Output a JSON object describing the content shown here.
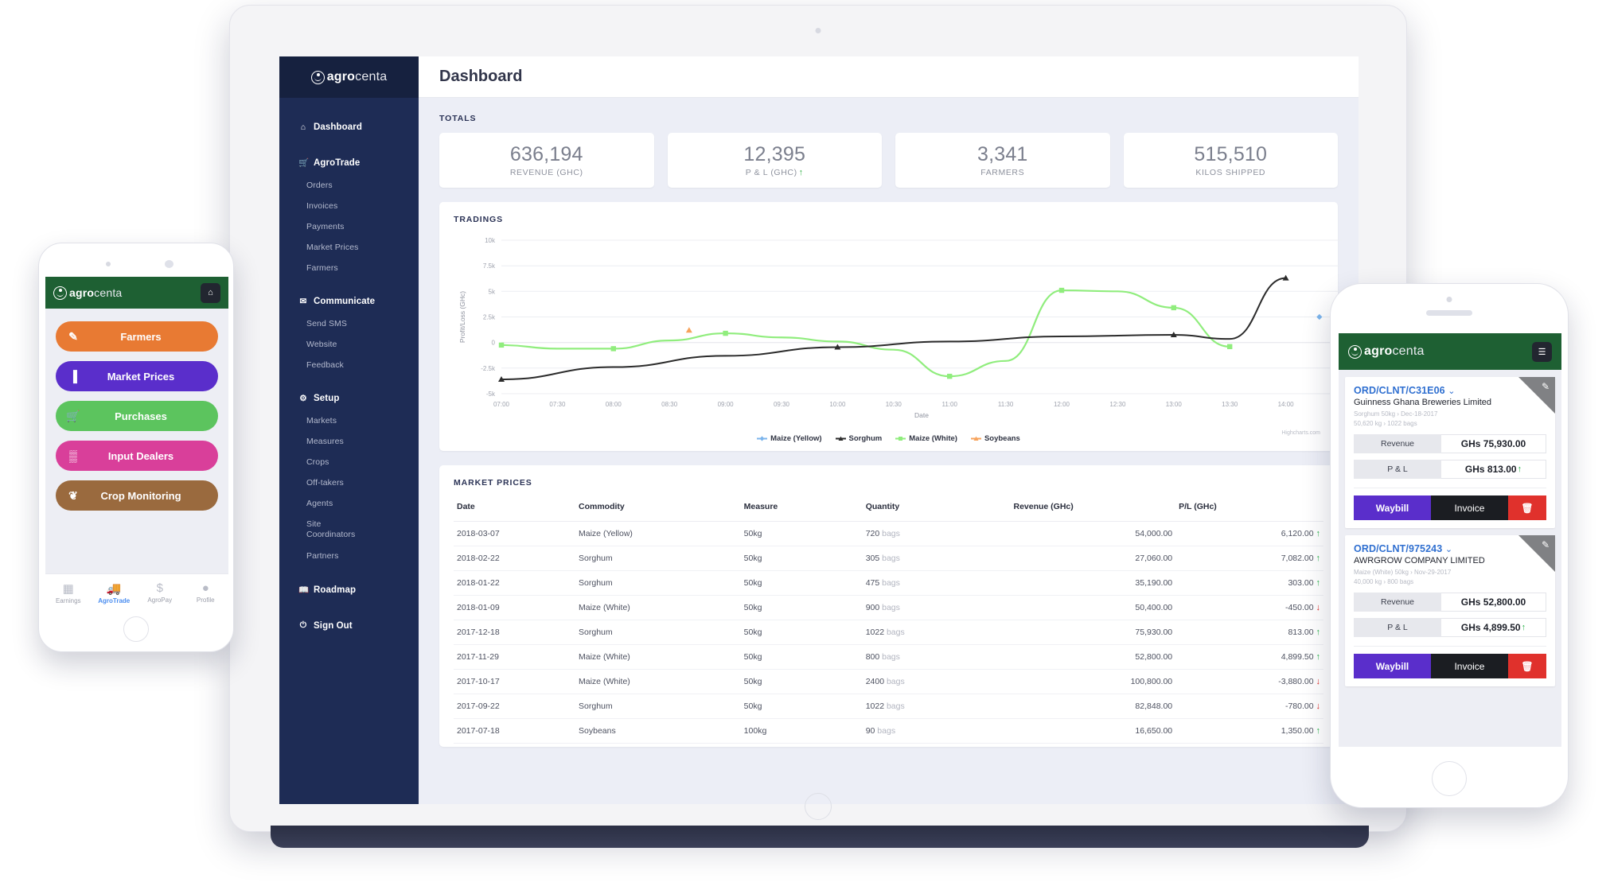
{
  "brand": {
    "name_bold": "agro",
    "name_light": "centa"
  },
  "tablet": {
    "sidebar": {
      "groups": [
        {
          "icon": "home-icon",
          "glyph": "⌂",
          "label": "Dashboard",
          "items": []
        },
        {
          "icon": "cart-icon",
          "glyph": "🛒",
          "label": "AgroTrade",
          "items": [
            "Orders",
            "Invoices",
            "Payments",
            "Market Prices",
            "Farmers"
          ]
        },
        {
          "icon": "envelope-icon",
          "glyph": "✉",
          "label": "Communicate",
          "items": [
            "Send SMS",
            "Website",
            "Feedback"
          ]
        },
        {
          "icon": "gear-icon",
          "glyph": "⚙",
          "label": "Setup",
          "items": [
            "Markets",
            "Measures",
            "Crops",
            "Off-takers",
            "Agents",
            "Site Coordinators",
            "Partners"
          ]
        },
        {
          "icon": "book-icon",
          "glyph": "📖",
          "label": "Roadmap",
          "items": []
        },
        {
          "icon": "power-icon",
          "glyph": "⏻",
          "label": "Sign Out",
          "items": []
        }
      ]
    },
    "header": {
      "title": "Dashboard"
    },
    "totals": {
      "section_label": "TOTALS",
      "cards": [
        {
          "value": "636,194",
          "caption": "REVENUE (GHC)",
          "trend": ""
        },
        {
          "value": "12,395",
          "caption": "P & L (GHC)",
          "trend": "↑"
        },
        {
          "value": "3,341",
          "caption": "FARMERS",
          "trend": ""
        },
        {
          "value": "515,510",
          "caption": "KILOS SHIPPED",
          "trend": ""
        }
      ]
    },
    "tradings": {
      "section_label": "TRADINGS",
      "credit": "Highcharts.com"
    },
    "market_prices": {
      "section_label": "MARKET PRICES",
      "columns": [
        "Date",
        "Commodity",
        "Measure",
        "Quantity",
        "Revenue (GHc)",
        "P/L (GHc)"
      ],
      "rows": [
        {
          "date": "2018-03-07",
          "commodity": "Maize (Yellow)",
          "measure": "50kg",
          "qty": "720",
          "unit": "bags",
          "revenue": "54,000.00",
          "pl": "6,120.00",
          "dir": "up"
        },
        {
          "date": "2018-02-22",
          "commodity": "Sorghum",
          "measure": "50kg",
          "qty": "305",
          "unit": "bags",
          "revenue": "27,060.00",
          "pl": "7,082.00",
          "dir": "up"
        },
        {
          "date": "2018-01-22",
          "commodity": "Sorghum",
          "measure": "50kg",
          "qty": "475",
          "unit": "bags",
          "revenue": "35,190.00",
          "pl": "303.00",
          "dir": "up"
        },
        {
          "date": "2018-01-09",
          "commodity": "Maize (White)",
          "measure": "50kg",
          "qty": "900",
          "unit": "bags",
          "revenue": "50,400.00",
          "pl": "-450.00",
          "dir": "down"
        },
        {
          "date": "2017-12-18",
          "commodity": "Sorghum",
          "measure": "50kg",
          "qty": "1022",
          "unit": "bags",
          "revenue": "75,930.00",
          "pl": "813.00",
          "dir": "up"
        },
        {
          "date": "2017-11-29",
          "commodity": "Maize (White)",
          "measure": "50kg",
          "qty": "800",
          "unit": "bags",
          "revenue": "52,800.00",
          "pl": "4,899.50",
          "dir": "up"
        },
        {
          "date": "2017-10-17",
          "commodity": "Maize (White)",
          "measure": "50kg",
          "qty": "2400",
          "unit": "bags",
          "revenue": "100,800.00",
          "pl": "-3,880.00",
          "dir": "down"
        },
        {
          "date": "2017-09-22",
          "commodity": "Sorghum",
          "measure": "50kg",
          "qty": "1022",
          "unit": "bags",
          "revenue": "82,848.00",
          "pl": "-780.00",
          "dir": "down"
        },
        {
          "date": "2017-07-18",
          "commodity": "Soybeans",
          "measure": "100kg",
          "qty": "90",
          "unit": "bags",
          "revenue": "16,650.00",
          "pl": "1,350.00",
          "dir": "up"
        }
      ]
    }
  },
  "phone_left": {
    "home_button_icon": "home-icon",
    "menu": [
      {
        "label": "Farmers",
        "color": "#e87a33",
        "icon": "edit-square-icon",
        "glyph": "✎"
      },
      {
        "label": "Market Prices",
        "color": "#5a2ecb",
        "icon": "bar-chart-icon",
        "glyph": "▐"
      },
      {
        "label": "Purchases",
        "color": "#5cc45e",
        "icon": "cart-icon",
        "glyph": "🛒"
      },
      {
        "label": "Input Dealers",
        "color": "#d93f9a",
        "icon": "building-icon",
        "glyph": "▒"
      },
      {
        "label": "Crop Monitoring",
        "color": "#9a6a3e",
        "icon": "leaf-icon",
        "glyph": "❦"
      }
    ],
    "tabs": [
      {
        "label": "Earnings",
        "icon": "calculator-icon",
        "glyph": "▦",
        "active": false
      },
      {
        "label": "AgroTrade",
        "icon": "truck-icon",
        "glyph": "🚚",
        "active": true
      },
      {
        "label": "AgroPay",
        "icon": "dollar-icon",
        "glyph": "$",
        "active": false
      },
      {
        "label": "Profile",
        "icon": "person-icon",
        "glyph": "●",
        "active": false
      }
    ]
  },
  "phone_right": {
    "list_button_icon": "list-icon",
    "orders": [
      {
        "id": "ORD/CLNT/C31E06",
        "chevron": "⌄",
        "company": "Guinness Ghana Breweries Limited",
        "meta_line1": "Sorghum 50kg  ›   Dec-18-2017",
        "meta_line2": "50,620 kg  ›   1022 bags",
        "revenue_label": "Revenue",
        "revenue_value": "GHs 75,930.00",
        "pl_label": "P & L",
        "pl_value": "GHs 813.00",
        "pl_trend": "↑",
        "waybill_label": "Waybill",
        "invoice_label": "Invoice",
        "delete_icon": "trash-icon",
        "delete_glyph": "🗑"
      },
      {
        "id": "ORD/CLNT/975243",
        "chevron": "⌄",
        "company": "AWRGROW COMPANY LIMITED",
        "meta_line1": "Maize (White) 50kg  ›   Nov-29-2017",
        "meta_line2": "40,000 kg  ›   800 bags",
        "revenue_label": "Revenue",
        "revenue_value": "GHs 52,800.00",
        "pl_label": "P & L",
        "pl_value": "GHs 4,899.50",
        "pl_trend": "↑",
        "waybill_label": "Waybill",
        "invoice_label": "Invoice",
        "delete_icon": "trash-icon",
        "delete_glyph": "🗑"
      }
    ]
  },
  "chart_data": {
    "type": "line",
    "title": "TRADINGS",
    "xlabel": "Date",
    "ylabel": "Profit/Loss (GHc)",
    "ylim": [
      -5000,
      10000
    ],
    "yticks": [
      "-5k",
      "-2.5k",
      "0",
      "2.5k",
      "5k",
      "7.5k",
      "10k"
    ],
    "ytick_values": [
      -5000,
      -2500,
      0,
      2500,
      5000,
      7500,
      10000
    ],
    "x": [
      "07:00",
      "07:30",
      "08:00",
      "08:30",
      "09:00",
      "09:30",
      "10:00",
      "10:30",
      "11:00",
      "11:30",
      "12:00",
      "12:30",
      "13:00",
      "13:30",
      "14:00"
    ],
    "grid": true,
    "legend_position": "bottom",
    "series": [
      {
        "name": "Maize (Yellow)",
        "color": "#7cb5ec",
        "symbol": "diamond",
        "points": [
          {
            "x": "14:30",
            "y": 2500
          }
        ]
      },
      {
        "name": "Sorghum",
        "color": "#2b2b2b",
        "symbol": "triangle",
        "values": [
          -3880,
          null,
          null,
          null,
          null,
          null,
          303,
          null,
          null,
          813,
          null,
          1350,
          813,
          850,
          7082
        ]
      },
      {
        "name": "Maize (White)",
        "color": "#90ed7d",
        "symbol": "square",
        "values": [
          -250,
          null,
          -450,
          null,
          900,
          null,
          300,
          null,
          -3880,
          null,
          5100,
          null,
          4400,
          -450,
          null
        ]
      },
      {
        "name": "Soybeans",
        "color": "#f7a35c",
        "symbol": "triangle",
        "points": [
          {
            "x": "08:40",
            "y": 1350
          }
        ]
      }
    ]
  }
}
